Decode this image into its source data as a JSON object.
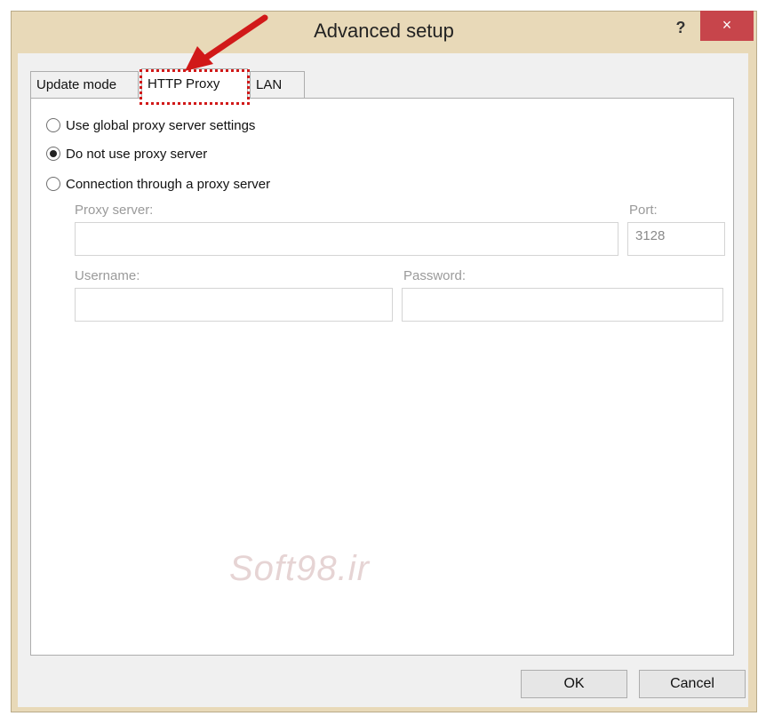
{
  "window": {
    "title": "Advanced setup",
    "help_label": "?",
    "close_label": "×"
  },
  "tabs": [
    {
      "label": "Update mode",
      "active": false
    },
    {
      "label": "HTTP Proxy",
      "active": true
    },
    {
      "label": "LAN",
      "active": false
    }
  ],
  "proxy": {
    "options": [
      {
        "label": "Use global proxy server settings",
        "checked": false
      },
      {
        "label": "Do not use proxy server",
        "checked": true
      },
      {
        "label": "Connection through a proxy server",
        "checked": false
      }
    ],
    "server_label": "Proxy server:",
    "server_value": "",
    "port_label": "Port:",
    "port_value": "3128",
    "username_label": "Username:",
    "username_value": "",
    "password_label": "Password:",
    "password_value": ""
  },
  "buttons": {
    "ok": "OK",
    "cancel": "Cancel"
  },
  "annotation": {
    "color": "#d11919"
  }
}
